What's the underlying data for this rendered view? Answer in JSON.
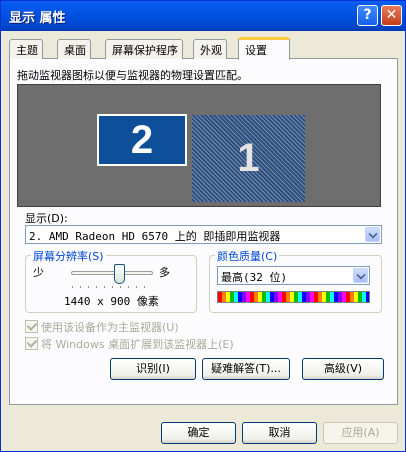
{
  "window": {
    "title": "显示 属性",
    "help_button": "?",
    "close_button": "✕"
  },
  "tabs": [
    {
      "label": "主题"
    },
    {
      "label": "桌面"
    },
    {
      "label": "屏幕保护程序"
    },
    {
      "label": "外观"
    },
    {
      "label": "设置",
      "active": true
    }
  ],
  "settings": {
    "instruction": "拖动监视器图标以便与监视器的物理设置匹配。",
    "monitors": [
      {
        "number": "2",
        "selected": true
      },
      {
        "number": "1",
        "selected": false
      }
    ],
    "display_label": "显示(D):",
    "display_value": "2. AMD Radeon HD 6570 上的 即插即用监视器",
    "resolution": {
      "group_label": "屏幕分辨率(S)",
      "less_label": "少",
      "more_label": "多",
      "value_text": "1440 x 900 像素"
    },
    "color_quality": {
      "group_label": "颜色质量(C)",
      "value": "最高(32 位)"
    },
    "checkbox_primary": {
      "label": "使用该设备作为主监视器(U)",
      "checked": true,
      "enabled": false
    },
    "checkbox_extend": {
      "label": "将 Windows 桌面扩展到该监视器上(E)",
      "checked": true,
      "enabled": false
    },
    "identify_button": "识别(I)",
    "troubleshoot_button": "疑难解答(T)...",
    "advanced_button": "高级(V)"
  },
  "footer": {
    "ok_label": "确定",
    "cancel_label": "取消",
    "apply_label": "应用(A)"
  },
  "colors": {
    "titlebar": "#0052e3",
    "selected_monitor": "#0e4f9a",
    "tab_highlight": "#ffc83c",
    "group_legend": "#0046d5"
  }
}
